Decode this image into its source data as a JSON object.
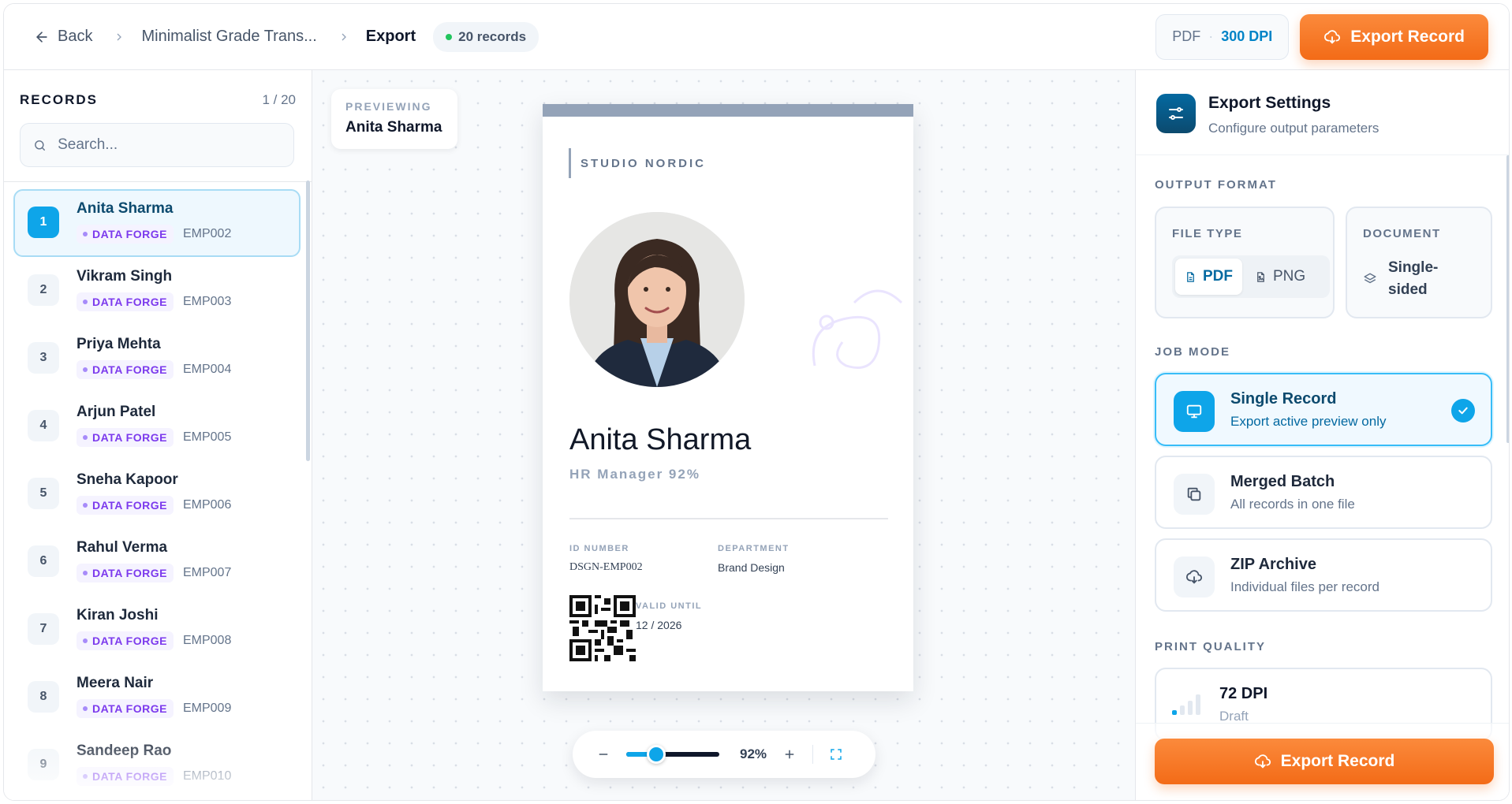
{
  "header": {
    "back_label": "Back",
    "crumbs": [
      "Minimalist Grade Trans...",
      "Export"
    ],
    "records_pill": "20 records",
    "format_chip": {
      "type": "PDF",
      "dpi": "300 DPI"
    },
    "export_label": "Export Record"
  },
  "sidebar": {
    "title": "RECORDS",
    "count": "1 / 20",
    "search_placeholder": "Search...",
    "items": [
      {
        "num": "1",
        "name": "Anita Sharma",
        "tag": "DATA FORGE",
        "emp": "EMP002",
        "active": true
      },
      {
        "num": "2",
        "name": "Vikram Singh",
        "tag": "DATA FORGE",
        "emp": "EMP003"
      },
      {
        "num": "3",
        "name": "Priya Mehta",
        "tag": "DATA FORGE",
        "emp": "EMP004"
      },
      {
        "num": "4",
        "name": "Arjun Patel",
        "tag": "DATA FORGE",
        "emp": "EMP005"
      },
      {
        "num": "5",
        "name": "Sneha Kapoor",
        "tag": "DATA FORGE",
        "emp": "EMP006"
      },
      {
        "num": "6",
        "name": "Rahul Verma",
        "tag": "DATA FORGE",
        "emp": "EMP007"
      },
      {
        "num": "7",
        "name": "Kiran Joshi",
        "tag": "DATA FORGE",
        "emp": "EMP008"
      },
      {
        "num": "8",
        "name": "Meera Nair",
        "tag": "DATA FORGE",
        "emp": "EMP009"
      },
      {
        "num": "9",
        "name": "Sandeep Rao",
        "tag": "DATA FORGE",
        "emp": "EMP010"
      }
    ]
  },
  "canvas": {
    "previewing_label": "PREVIEWING",
    "previewing_name": "Anita Sharma",
    "card": {
      "studio": "STUDIO NORDIC",
      "name": "Anita Sharma",
      "role": "HR Manager  92%",
      "id_label": "ID NUMBER",
      "id_value": "DSGN-EMP002",
      "dept_label": "DEPARTMENT",
      "dept_value": "Brand Design",
      "valid_label": "VALID UNTIL",
      "valid_value": "12 / 2026"
    },
    "zoom": {
      "value": 0.32,
      "label": "92%"
    }
  },
  "settings": {
    "title": "Export Settings",
    "subtitle": "Configure output parameters",
    "output_format_label": "OUTPUT FORMAT",
    "file_type_label": "FILE TYPE",
    "file_types": [
      "PDF",
      "PNG"
    ],
    "document_label": "DOCUMENT",
    "document_value": "Single-sided",
    "job_mode_label": "JOB MODE",
    "modes": [
      {
        "title": "Single Record",
        "sub": "Export active preview only"
      },
      {
        "title": "Merged Batch",
        "sub": "All records in one file"
      },
      {
        "title": "ZIP Archive",
        "sub": "Individual files per record"
      }
    ],
    "print_quality_label": "PRINT QUALITY",
    "quality": {
      "title": "72 DPI",
      "sub": "Draft"
    },
    "export_label": "Export Record"
  },
  "colors": {
    "accent": "#0ea5e9",
    "cta": "#f36b17",
    "tag": "#7c3aed"
  }
}
